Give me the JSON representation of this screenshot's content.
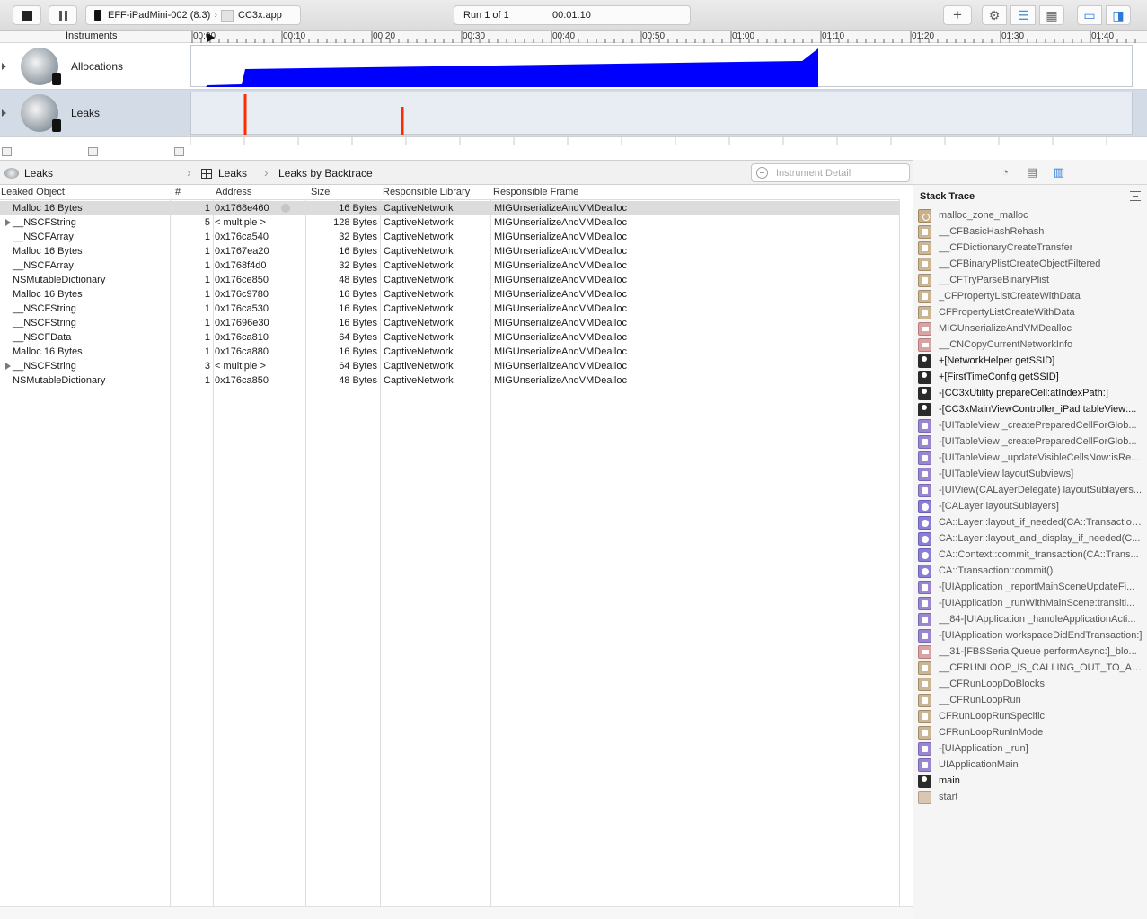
{
  "toolbar": {
    "device": "EFF-iPadMini-002 (8.3)",
    "app": "CC3x.app",
    "run_label": "Run 1 of 1",
    "elapsed": "00:01:10",
    "add_label": "+"
  },
  "timeline": {
    "header": "Instruments",
    "ticks": [
      "00:00",
      "00:10",
      "00:20",
      "00:30",
      "00:40",
      "00:50",
      "01:00",
      "01:10",
      "01:20",
      "01:30",
      "01:40"
    ],
    "tracks": [
      {
        "name": "Allocations",
        "color": "#0000ff"
      },
      {
        "name": "Leaks",
        "color": "#ff2a00"
      }
    ],
    "leak_marks_seconds": [
      6,
      23.5
    ],
    "allocations_end_seconds": 70
  },
  "navbar": {
    "instrument": "Leaks",
    "view": "Leaks",
    "mode": "Leaks by Backtrace",
    "search_placeholder": "Instrument Detail"
  },
  "table": {
    "columns": [
      "Leaked Object",
      "#",
      "Address",
      "Size",
      "Responsible Library",
      "Responsible Frame"
    ],
    "rows": [
      {
        "object": "Malloc 16 Bytes",
        "count": "1",
        "address": "0x1768e460",
        "size": "16 Bytes",
        "library": "CaptiveNetwork",
        "frame": "MIGUnserializeAndVMDealloc",
        "expandable": false,
        "selected": true
      },
      {
        "object": "__NSCFString",
        "count": "5",
        "address": "< multiple >",
        "size": "128 Bytes",
        "library": "CaptiveNetwork",
        "frame": "MIGUnserializeAndVMDealloc",
        "expandable": true,
        "selected": false
      },
      {
        "object": "__NSCFArray",
        "count": "1",
        "address": "0x176ca540",
        "size": "32 Bytes",
        "library": "CaptiveNetwork",
        "frame": "MIGUnserializeAndVMDealloc",
        "expandable": false,
        "selected": false
      },
      {
        "object": "Malloc 16 Bytes",
        "count": "1",
        "address": "0x1767ea20",
        "size": "16 Bytes",
        "library": "CaptiveNetwork",
        "frame": "MIGUnserializeAndVMDealloc",
        "expandable": false,
        "selected": false
      },
      {
        "object": "__NSCFArray",
        "count": "1",
        "address": "0x1768f4d0",
        "size": "32 Bytes",
        "library": "CaptiveNetwork",
        "frame": "MIGUnserializeAndVMDealloc",
        "expandable": false,
        "selected": false
      },
      {
        "object": "NSMutableDictionary",
        "count": "1",
        "address": "0x176ce850",
        "size": "48 Bytes",
        "library": "CaptiveNetwork",
        "frame": "MIGUnserializeAndVMDealloc",
        "expandable": false,
        "selected": false
      },
      {
        "object": "Malloc 16 Bytes",
        "count": "1",
        "address": "0x176c9780",
        "size": "16 Bytes",
        "library": "CaptiveNetwork",
        "frame": "MIGUnserializeAndVMDealloc",
        "expandable": false,
        "selected": false
      },
      {
        "object": "__NSCFString",
        "count": "1",
        "address": "0x176ca530",
        "size": "16 Bytes",
        "library": "CaptiveNetwork",
        "frame": "MIGUnserializeAndVMDealloc",
        "expandable": false,
        "selected": false
      },
      {
        "object": "__NSCFString",
        "count": "1",
        "address": "0x17696e30",
        "size": "16 Bytes",
        "library": "CaptiveNetwork",
        "frame": "MIGUnserializeAndVMDealloc",
        "expandable": false,
        "selected": false
      },
      {
        "object": "__NSCFData",
        "count": "1",
        "address": "0x176ca810",
        "size": "64 Bytes",
        "library": "CaptiveNetwork",
        "frame": "MIGUnserializeAndVMDealloc",
        "expandable": false,
        "selected": false
      },
      {
        "object": "Malloc 16 Bytes",
        "count": "1",
        "address": "0x176ca880",
        "size": "16 Bytes",
        "library": "CaptiveNetwork",
        "frame": "MIGUnserializeAndVMDealloc",
        "expandable": false,
        "selected": false
      },
      {
        "object": "__NSCFString",
        "count": "3",
        "address": "< multiple >",
        "size": "64 Bytes",
        "library": "CaptiveNetwork",
        "frame": "MIGUnserializeAndVMDealloc",
        "expandable": true,
        "selected": false
      },
      {
        "object": "NSMutableDictionary",
        "count": "1",
        "address": "0x176ca850",
        "size": "48 Bytes",
        "library": "CaptiveNetwork",
        "frame": "MIGUnserializeAndVMDealloc",
        "expandable": false,
        "selected": false
      }
    ]
  },
  "inspector": {
    "title": "Stack Trace",
    "frames": [
      {
        "label": "malloc_zone_malloc",
        "icon": "malloc"
      },
      {
        "label": "__CFBasicHashRehash",
        "icon": "lib"
      },
      {
        "label": "__CFDictionaryCreateTransfer",
        "icon": "lib"
      },
      {
        "label": "__CFBinaryPlistCreateObjectFiltered",
        "icon": "lib"
      },
      {
        "label": "__CFTryParseBinaryPlist",
        "icon": "lib"
      },
      {
        "label": "_CFPropertyListCreateWithData",
        "icon": "lib"
      },
      {
        "label": "CFPropertyListCreateWithData",
        "icon": "lib"
      },
      {
        "label": "MIGUnserializeAndVMDealloc",
        "icon": "red"
      },
      {
        "label": "__CNCopyCurrentNetworkInfo",
        "icon": "red"
      },
      {
        "label": "+[NetworkHelper getSSID]",
        "icon": "user"
      },
      {
        "label": "+[FirstTimeConfig getSSID]",
        "icon": "user"
      },
      {
        "label": "-[CC3xUtility prepareCell:atIndexPath:]",
        "icon": "user"
      },
      {
        "label": "-[CC3xMainViewController_iPad tableView:...",
        "icon": "user"
      },
      {
        "label": "-[UITableView _createPreparedCellForGlob...",
        "icon": "uikit"
      },
      {
        "label": "-[UITableView _createPreparedCellForGlob...",
        "icon": "uikit"
      },
      {
        "label": "-[UITableView _updateVisibleCellsNow:isRe...",
        "icon": "uikit"
      },
      {
        "label": "-[UITableView layoutSubviews]",
        "icon": "uikit"
      },
      {
        "label": "-[UIView(CALayerDelegate) layoutSublayers...",
        "icon": "uikit"
      },
      {
        "label": "-[CALayer layoutSublayers]",
        "icon": "qc"
      },
      {
        "label": "CA::Layer::layout_if_needed(CA::Transaction*)",
        "icon": "qc"
      },
      {
        "label": "CA::Layer::layout_and_display_if_needed(C...",
        "icon": "qc"
      },
      {
        "label": "CA::Context::commit_transaction(CA::Trans...",
        "icon": "qc"
      },
      {
        "label": "CA::Transaction::commit()",
        "icon": "qc"
      },
      {
        "label": "-[UIApplication _reportMainSceneUpdateFi...",
        "icon": "uikit"
      },
      {
        "label": "-[UIApplication _runWithMainScene:transiti...",
        "icon": "uikit"
      },
      {
        "label": "__84-[UIApplication _handleApplicationActi...",
        "icon": "uikit"
      },
      {
        "label": "-[UIApplication workspaceDidEndTransaction:]",
        "icon": "uikit"
      },
      {
        "label": "__31-[FBSSerialQueue performAsync:]_blo...",
        "icon": "red"
      },
      {
        "label": "__CFRUNLOOP_IS_CALLING_OUT_TO_A_...",
        "icon": "lib"
      },
      {
        "label": "__CFRunLoopDoBlocks",
        "icon": "lib"
      },
      {
        "label": "__CFRunLoopRun",
        "icon": "lib"
      },
      {
        "label": "CFRunLoopRunSpecific",
        "icon": "lib"
      },
      {
        "label": "CFRunLoopRunInMode",
        "icon": "lib"
      },
      {
        "label": "-[UIApplication _run]",
        "icon": "uikit"
      },
      {
        "label": "UIApplicationMain",
        "icon": "uikit"
      },
      {
        "label": "main",
        "icon": "user"
      },
      {
        "label": "start",
        "icon": "dyld"
      }
    ]
  }
}
